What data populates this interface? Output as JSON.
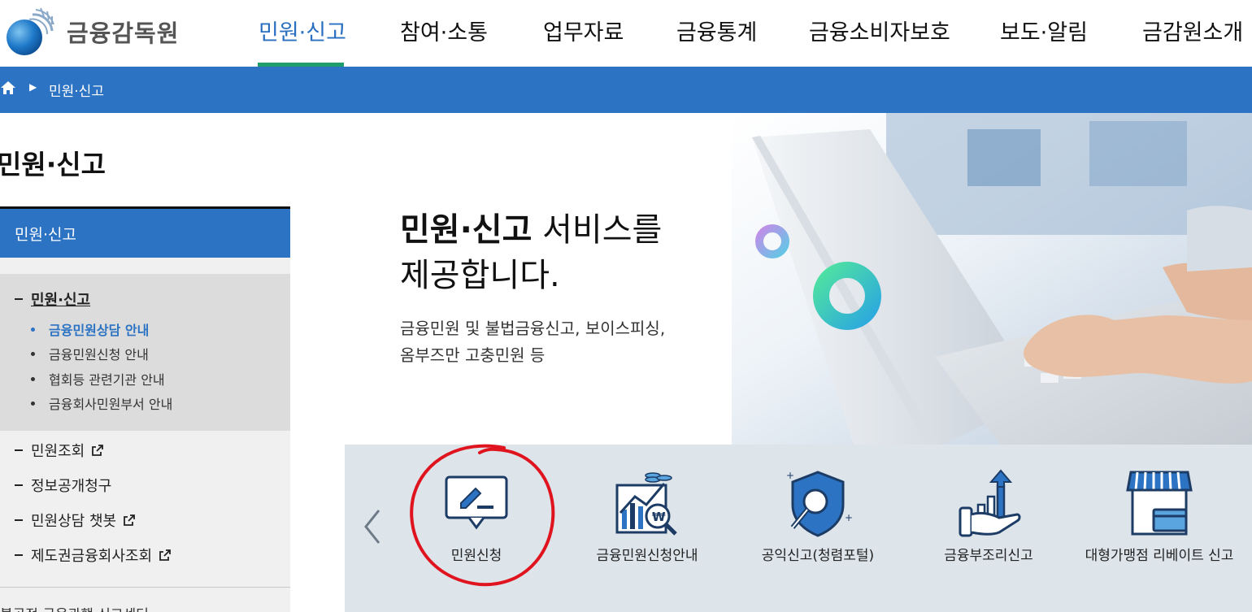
{
  "header": {
    "logo_text": "금융감독원",
    "nav": [
      {
        "label": "민원·신고",
        "active": true
      },
      {
        "label": "참여·소통"
      },
      {
        "label": "업무자료"
      },
      {
        "label": "금융통계"
      },
      {
        "label": "금융소비자보호"
      },
      {
        "label": "보도·알림"
      },
      {
        "label": "금감원소개"
      }
    ],
    "active_color": "#2a6fc0",
    "underline_color": "#1f9d6b"
  },
  "breadcrumb": {
    "home_icon": "home-icon",
    "current": "민원·신고"
  },
  "sidebar": {
    "title": "민원·신고",
    "head": "민원·신고",
    "group": {
      "label": "민원·신고",
      "children": [
        {
          "label": "금융민원상담 안내",
          "active": true
        },
        {
          "label": "금융민원신청 안내"
        },
        {
          "label": "협회등 관련기관 안내"
        },
        {
          "label": "금융회사민원부서 안내"
        }
      ]
    },
    "items": [
      {
        "label": "민원조회",
        "external": true
      },
      {
        "label": "정보공개청구",
        "external": false
      },
      {
        "label": "민원상담 챗봇",
        "external": true
      },
      {
        "label": "제도권금융회사조회",
        "external": true
      }
    ],
    "cutoff_text": "불공정 금융관행 신고센터"
  },
  "hero": {
    "title_bold": "민원·신고",
    "title_rest": " 서비스를",
    "title_line2": "제공합니다.",
    "desc_line1": "금융민원 및 불법금융신고, 보이스피싱,",
    "desc_line2": "옴부즈만 고충민원 등"
  },
  "quick_menu": {
    "prev_icon": "chevron-left-icon",
    "items": [
      {
        "label": "민원신청",
        "icon": "complaint-form-icon",
        "highlighted": true
      },
      {
        "label": "금융민원신청안내",
        "icon": "financial-chart-icon"
      },
      {
        "label": "공익신고(청렴포털)",
        "icon": "shield-search-icon"
      },
      {
        "label": "금융부조리신고",
        "icon": "hand-growth-icon"
      },
      {
        "label": "대형가맹점 리베이트 신고",
        "icon": "store-card-icon"
      }
    ],
    "annotation_color": "#e0141e"
  }
}
